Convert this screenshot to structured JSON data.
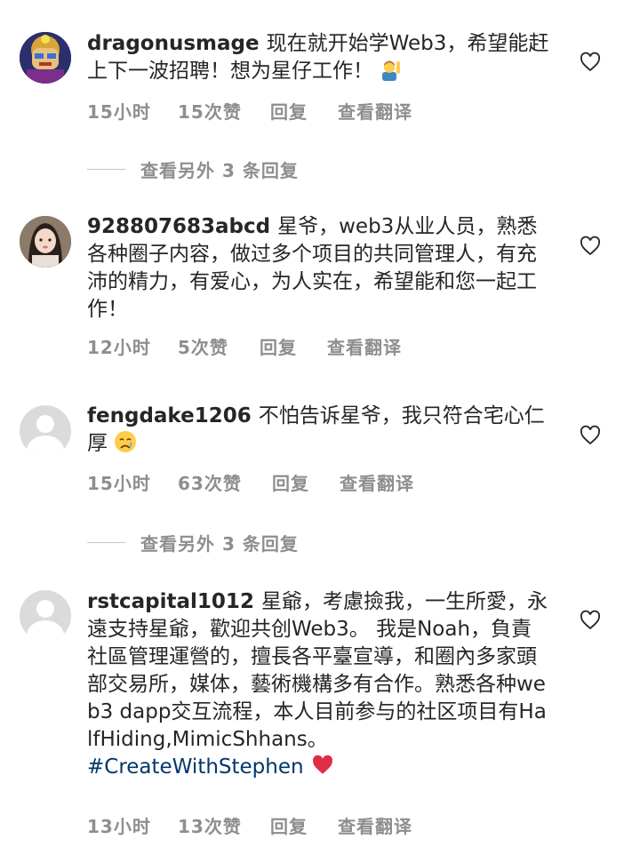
{
  "comments": [
    {
      "username": "dragonusmage",
      "text": "现在就开始学Web3，希望能赶上下一波招聘！想为星仔工作！",
      "emoji": "person-raising-hand",
      "time": "15小时",
      "likes": "15次赞",
      "reply": "回复",
      "translate": "查看翻译"
    },
    {
      "username": "928807683abcd",
      "text": "星爷，web3从业人员，熟悉各种圈子内容，做过多个项目的共同管理人，有充沛的精力，有爱心，为人实在，希望能和您一起工作！",
      "time": "12小时",
      "likes": "5次赞",
      "reply": "回复",
      "translate": "查看翻译"
    },
    {
      "username": "fengdake1206",
      "text": "不怕告诉星爷，我只符合宅心仁厚",
      "emoji": "crying-face",
      "time": "15小时",
      "likes": "63次赞",
      "reply": "回复",
      "translate": "查看翻译"
    },
    {
      "username": "rstcapital1012",
      "text": "星爺，考慮撿我，一生所愛，永遠支持星爺，歡迎共创Web3。 我是Noah，負責社區管理運營的，擅長各平臺宣導，和圈內多家頭部交易所，媒体，藝術機構多有合作。熟悉各种web3 dapp交互流程，本人目前参与的社区项目有HalfHiding,MimicShhans。",
      "hashtag": "#CreateWithStephen",
      "emoji": "red-heart",
      "time": "13小时",
      "likes": "13次赞",
      "reply": "回复",
      "translate": "查看翻译"
    }
  ],
  "view_replies": [
    {
      "label": "查看另外 3 条回复"
    },
    {
      "label": "查看另外 3 条回复"
    }
  ],
  "colors": {
    "text": "#262626",
    "meta": "#8e8e8e",
    "hashtag": "#00376b",
    "heart_outline": "#262626"
  }
}
